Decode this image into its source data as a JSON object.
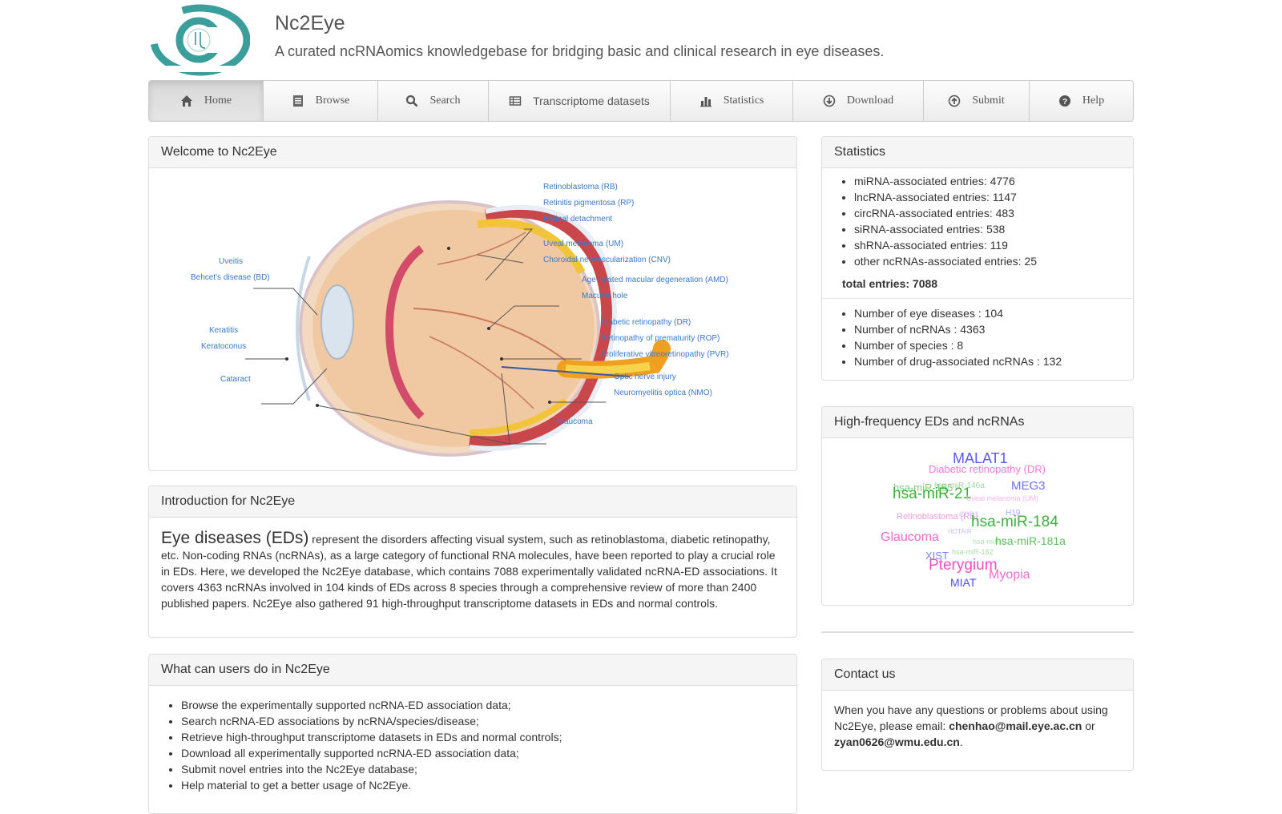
{
  "header": {
    "title": "Nc2Eye",
    "subtitle": "A curated ncRNAomics knowledgebase for bridging basic and clinical research in eye diseases."
  },
  "nav": [
    {
      "label": "Home",
      "icon": "home-icon"
    },
    {
      "label": "Browse",
      "icon": "list-icon"
    },
    {
      "label": "Search",
      "icon": "search-icon"
    },
    {
      "label": "Transcriptome datasets",
      "icon": "table-icon"
    },
    {
      "label": "Statistics",
      "icon": "bar-chart-icon"
    },
    {
      "label": "Download",
      "icon": "download-circle-icon"
    },
    {
      "label": "Submit",
      "icon": "upload-circle-icon"
    },
    {
      "label": "Help",
      "icon": "question-circle-icon"
    }
  ],
  "welcome": {
    "title": "Welcome to Nc2Eye",
    "labels": {
      "rb": "Retinoblastoma (RB)",
      "rp": "Retinitis pigmentosa (RP)",
      "rd": "Retinal detachment",
      "um": "Uveal melanoma (UM)",
      "cnv": "Choroidal neovascularization (CNV)",
      "amd": "Age-related macular degeneration (AMD)",
      "mh": "Macular hole",
      "dr": "Diabetic retinopathy (DR)",
      "rop": "Retinopathy of prematurity (ROP)",
      "pvr": "Proliferative vitreoretinopathy (PVR)",
      "oni": "Optic nerve injury",
      "nmo": "Neuromyelitis optica (NMO)",
      "glaucoma": "Glaucoma",
      "uveitis": "Uveitis",
      "bd": "Behcet's disease (BD)",
      "keratitis": "Keratitis",
      "keratoconus": "Keratoconus",
      "cataract": "Cataract"
    }
  },
  "intro": {
    "title": "Introduction for Nc2Eye",
    "lead": "Eye diseases (EDs)",
    "text": " represent the disorders affecting visual system, such as retinoblastoma, diabetic retinopathy, etc. Non-coding RNAs (ncRNAs), as a large category of functional RNA molecules, have been reported to play a crucial role in EDs. Here, we developed the Nc2Eye database, which contains 7088 experimentally validated ncRNA-ED associations. It covers 4363 ncRNAs involved in 104 kinds of EDs across 8 species through a comprehensive review of more than 2400 published papers. Nc2Eye also gathered 91 high-throughput transcriptome datasets in EDs and normal controls."
  },
  "what": {
    "title": "What can users do in Nc2Eye",
    "items": [
      "Browse the experimentally supported ncRNA-ED association data;",
      "Search ncRNA-ED associations by ncRNA/species/disease;",
      "Retrieve high-throughput transcriptome datasets in EDs and normal controls;",
      "Download all experimentally supported ncRNA-ED association data;",
      "Submit novel entries into the Nc2Eye database;",
      "Help material to get a better usage of Nc2Eye."
    ]
  },
  "stats": {
    "title": "Statistics",
    "entries": [
      "miRNA-associated entries: 4776",
      "lncRNA-associated entries: 1147",
      "circRNA-associated entries: 483",
      "siRNA-associated entries: 538",
      "shRNA-associated entries: 119",
      "other ncRNAs-associated entries: 25"
    ],
    "total": "total entries: 7088",
    "numbers": [
      "Number of eye diseases : 104",
      "Number of ncRNAs : 4363",
      "Number of species : 8",
      "Number of drug-associated ncRNAs : 132"
    ]
  },
  "freq": {
    "title": "High-frequency EDs and ncRNAs",
    "words": [
      {
        "text": "MALAT1",
        "color": "#5b5bf5"
      },
      {
        "text": "Diabetic retinopathy (DR)",
        "color": "#f47ad8"
      },
      {
        "text": "hsa-miR-155",
        "color": "#7fcf7f"
      },
      {
        "text": "hsa-miR-146a",
        "color": "#9fd89f"
      },
      {
        "text": "MEG3",
        "color": "#6f6ff5"
      },
      {
        "text": "hsa-miR-21",
        "color": "#3fae3f"
      },
      {
        "text": "Uveal melanoma (UM)",
        "color": "#f7b4e8"
      },
      {
        "text": "Retinoblastoma (RB)",
        "color": "#f59be0"
      },
      {
        "text": "CDR1",
        "color": "#c7c7f9"
      },
      {
        "text": "H19",
        "color": "#a7a7f7"
      },
      {
        "text": "hsa-miR-184",
        "color": "#3fae3f"
      },
      {
        "text": "Glaucoma",
        "color": "#f06ad0"
      },
      {
        "text": "HOTAIR",
        "color": "#c2c2f8"
      },
      {
        "text": "hsa-miR-9",
        "color": "#b4e0b4"
      },
      {
        "text": "hsa-miR-181a",
        "color": "#5fbf5f"
      },
      {
        "text": "hsa-miR-182",
        "color": "#a8dca8"
      },
      {
        "text": "XIST",
        "color": "#8080f6"
      },
      {
        "text": "Pterygium",
        "color": "#ee4fc6"
      },
      {
        "text": "Myopia",
        "color": "#f070d2"
      },
      {
        "text": "MIAT",
        "color": "#5050f2"
      }
    ]
  },
  "contact": {
    "title": "Contact us",
    "text1": "When you have any questions or problems about using Nc2Eye, please email: ",
    "email1": "chenhao@mail.eye.ac.cn",
    "or": " or",
    "email2": "zyan0626@wmu.edu.cn",
    "end": "."
  }
}
